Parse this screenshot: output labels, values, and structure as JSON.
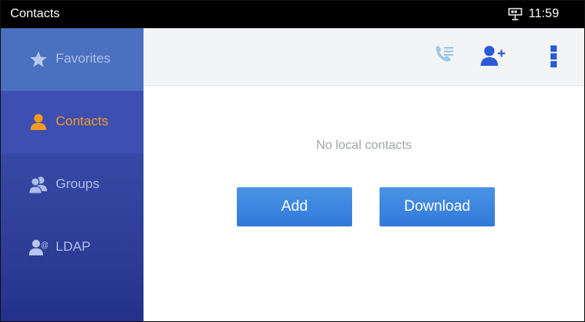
{
  "statusbar": {
    "title": "Contacts",
    "time": "11:59",
    "network_icon": "ethernet-icon"
  },
  "sidebar": {
    "items": [
      {
        "label": "Favorites",
        "icon": "star-icon"
      },
      {
        "label": "Contacts",
        "icon": "person-icon",
        "active": true
      },
      {
        "label": "Groups",
        "icon": "group-icon"
      },
      {
        "label": "LDAP",
        "icon": "ldap-icon"
      }
    ]
  },
  "toolbar": {
    "icons": [
      "call-log-icon",
      "add-contact-icon",
      "more-menu-icon"
    ]
  },
  "main": {
    "empty_message": "No local contacts",
    "add_label": "Add",
    "download_label": "Download"
  },
  "colors": {
    "accent": "#f39a23",
    "sidebar": "#3849a6",
    "button": "#3179d8",
    "toolbar_icon": "#2a5bd7"
  }
}
